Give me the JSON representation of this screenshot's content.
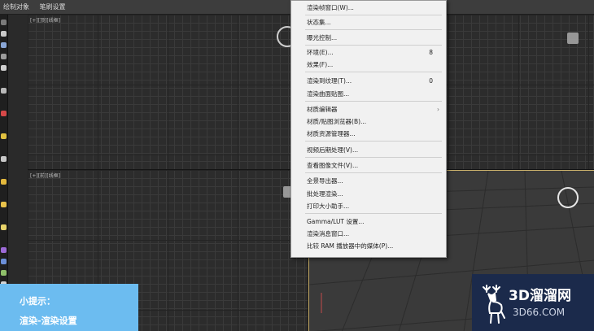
{
  "topbar": {
    "item_1": "绘制对象",
    "item_2": "笔刷设置"
  },
  "viewports": {
    "tl_label": "[+][顶][线框]",
    "bl_label": "[+][前][线框]"
  },
  "render_menu": {
    "items": [
      {
        "label": "渲染帧窗口(W)...",
        "key": ""
      },
      {
        "label": "状态集...",
        "key": ""
      },
      {
        "label": "曝光控制...",
        "key": ""
      },
      {
        "label": "环境(E)...",
        "key": "8"
      },
      {
        "label": "效果(F)...",
        "key": ""
      },
      {
        "label": "渲染到纹理(T)...",
        "key": "0"
      },
      {
        "label": "渲染曲面贴图...",
        "key": ""
      },
      {
        "label": "材质编辑器",
        "key": "",
        "submenu": true
      },
      {
        "label": "材质/贴图浏览器(B)...",
        "key": ""
      },
      {
        "label": "材质资源管理器...",
        "key": ""
      },
      {
        "label": "视频后期处理(V)...",
        "key": ""
      },
      {
        "label": "查看图像文件(V)...",
        "key": ""
      },
      {
        "label": "全景导出器...",
        "key": ""
      },
      {
        "label": "批处理渲染...",
        "key": ""
      },
      {
        "label": "打印大小助手...",
        "key": ""
      },
      {
        "label": "Gamma/LUT 设置...",
        "key": ""
      },
      {
        "label": "渲染消息窗口...",
        "key": ""
      },
      {
        "label": "比较 RAM 播放器中的媒体(P)...",
        "key": ""
      }
    ],
    "submenu_arrow": "›"
  },
  "tip": {
    "title": "小提示：",
    "text": "渲染-渲染设置"
  },
  "watermark": {
    "title": "3D溜溜网",
    "subtitle": "3D66.COM"
  },
  "colors": {
    "tip_bg": "#6cbcf0",
    "watermark_bg": "#1b2a4b",
    "active_viewport_border": "#c9b06a"
  }
}
